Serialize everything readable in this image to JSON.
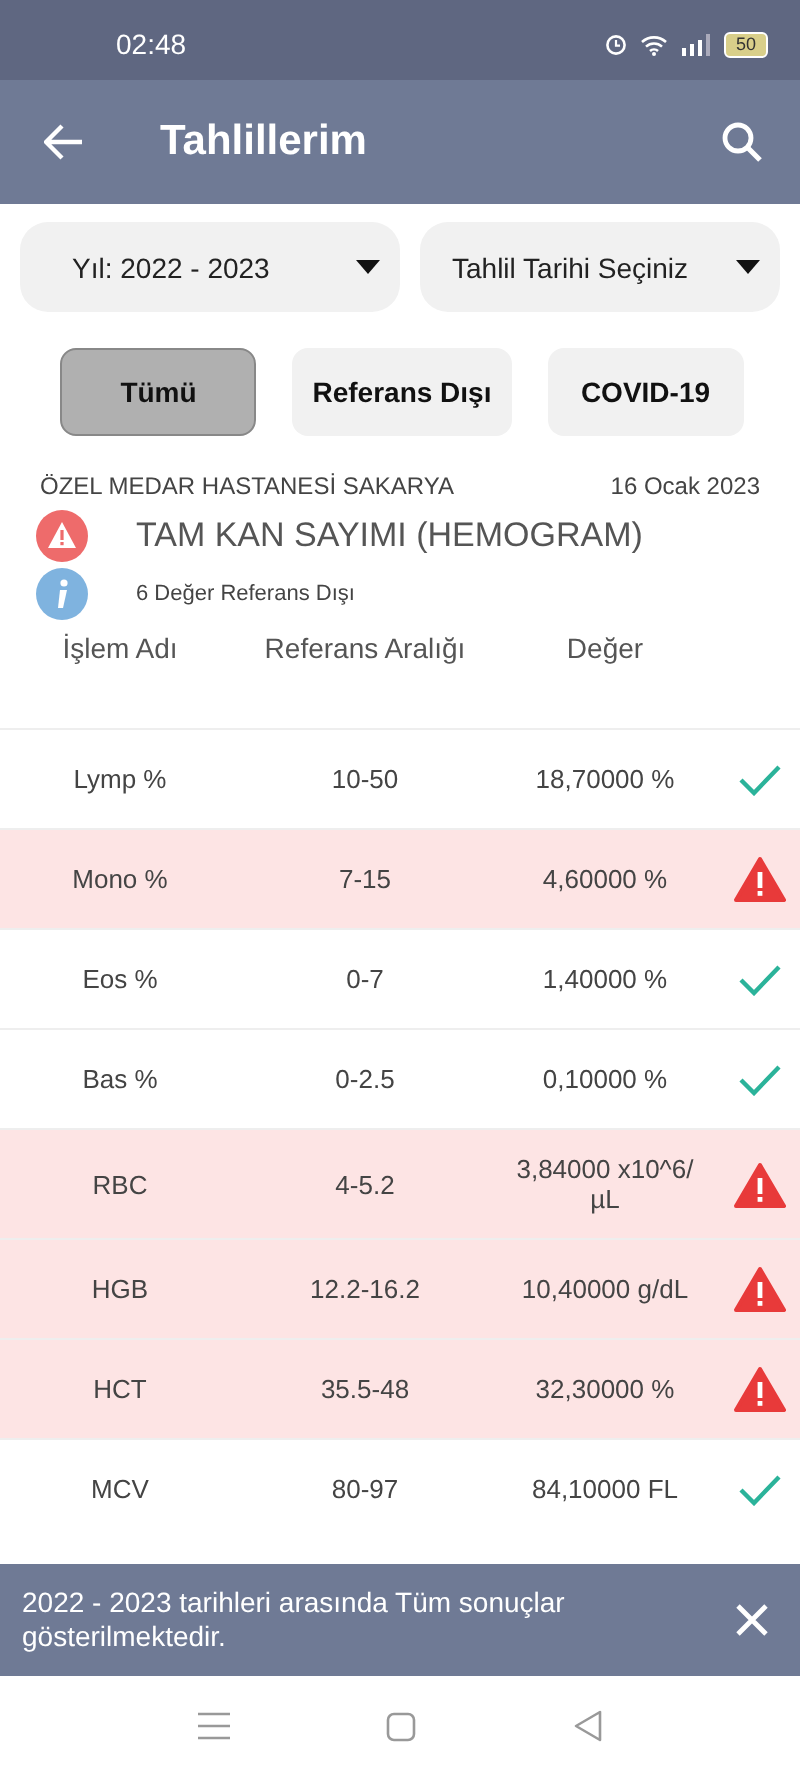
{
  "status_bar": {
    "time": "02:48",
    "battery": "50"
  },
  "header": {
    "title": "Tahlillerim"
  },
  "filters": [
    {
      "label": "Yıl: 2022 - 2023"
    },
    {
      "label": "Tahlil Tarihi Seçiniz"
    }
  ],
  "tabs": [
    {
      "label": "Tümü",
      "selected": true
    },
    {
      "label": "Referans Dışı",
      "selected": false
    },
    {
      "label": "COVID-19",
      "selected": false
    }
  ],
  "report": {
    "hospital": "ÖZEL MEDAR HASTANESİ SAKARYA",
    "date": "16 Ocak 2023",
    "test": "TAM KAN SAYIMI (HEMOGRAM)",
    "summary": "6 Değer Referans Dışı"
  },
  "table": {
    "columns": [
      "İşlem Adı",
      "Referans Aralığı",
      "Değer"
    ],
    "rows": [
      {
        "name": "Lymp %",
        "range": "10-50",
        "value": "18,70000 %",
        "out_of_range": false
      },
      {
        "name": "Mono %",
        "range": "7-15",
        "value": "4,60000 %",
        "out_of_range": true
      },
      {
        "name": "Eos %",
        "range": "0-7",
        "value": "1,40000 %",
        "out_of_range": false
      },
      {
        "name": "Bas %",
        "range": "0-2.5",
        "value": "0,10000 %",
        "out_of_range": false
      },
      {
        "name": "RBC",
        "range": "4-5.2",
        "value": "3,84000 x10^6/ µL",
        "out_of_range": true
      },
      {
        "name": "HGB",
        "range": "12.2-16.2",
        "value": "10,40000 g/dL",
        "out_of_range": true
      },
      {
        "name": "HCT",
        "range": "35.5-48",
        "value": "32,30000 %",
        "out_of_range": true
      },
      {
        "name": "MCV",
        "range": "80-97",
        "value": "84,10000 FL",
        "out_of_range": false
      }
    ]
  },
  "snackbar": {
    "message": "2022 - 2023 tarihleri arasında Tüm sonuçlar gösterilmektedir."
  }
}
